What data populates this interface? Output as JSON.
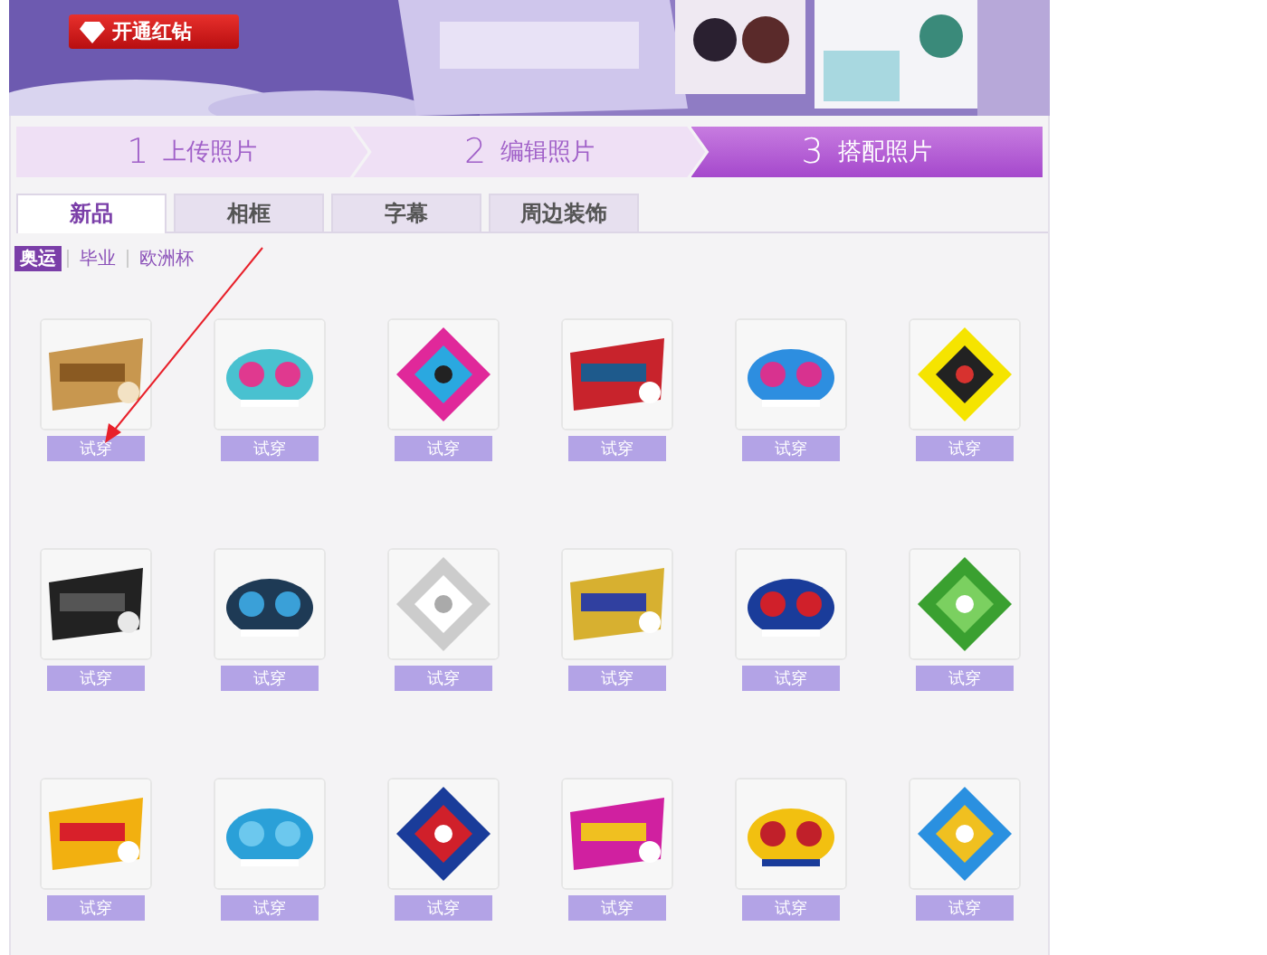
{
  "banner": {
    "kind": "picture",
    "button": "开通红钻"
  },
  "steps": [
    {
      "number": "1",
      "label": "上传照片",
      "selected": false
    },
    {
      "number": "2",
      "label": "编辑照片",
      "selected": false
    },
    {
      "number": "3",
      "label": "搭配照片",
      "selected": true
    }
  ],
  "tabs": [
    {
      "label": "新品",
      "selected": true
    },
    {
      "label": "相框",
      "selected": false
    },
    {
      "label": "字幕",
      "selected": false
    },
    {
      "label": "周边装饰",
      "selected": false
    }
  ],
  "subtabs": [
    {
      "label": "奥运",
      "selected": true
    },
    {
      "label": "毕业",
      "selected": false
    },
    {
      "label": "欧洲杯",
      "selected": false
    }
  ],
  "items": [
    {
      "kind": "picture",
      "button": "试穿"
    },
    {
      "kind": "picture",
      "button": "试穿"
    },
    {
      "kind": "picture",
      "button": "试穿"
    },
    {
      "kind": "picture",
      "button": "试穿"
    },
    {
      "kind": "picture",
      "button": "试穿"
    },
    {
      "kind": "picture",
      "button": "试穿"
    },
    {
      "kind": "picture",
      "button": "试穿"
    },
    {
      "kind": "picture",
      "button": "试穿"
    },
    {
      "kind": "picture",
      "button": "试穿"
    },
    {
      "kind": "picture",
      "button": "试穿"
    },
    {
      "kind": "picture",
      "button": "试穿"
    },
    {
      "kind": "picture",
      "button": "试穿"
    },
    {
      "kind": "picture",
      "button": "试穿"
    },
    {
      "kind": "picture",
      "button": "试穿"
    },
    {
      "kind": "picture",
      "button": "试穿"
    },
    {
      "kind": "picture",
      "button": "试穿"
    },
    {
      "kind": "picture",
      "button": "试穿"
    },
    {
      "kind": "picture",
      "button": "试穿"
    }
  ]
}
